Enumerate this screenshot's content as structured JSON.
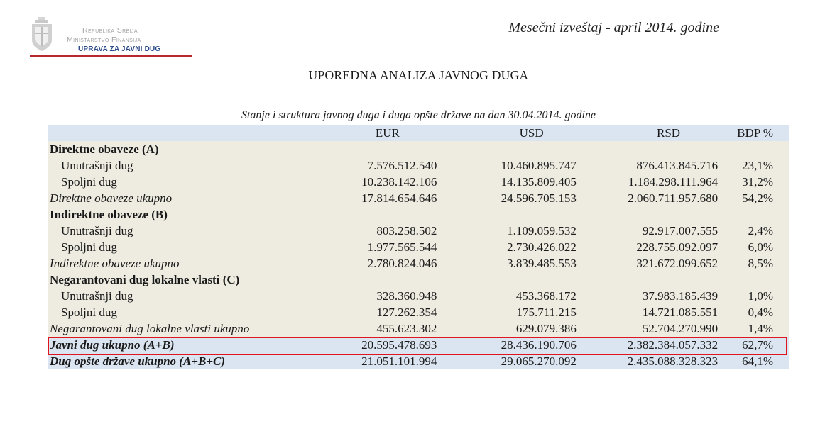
{
  "header": {
    "org_line1": "Republika Srbija",
    "org_line2": "Ministarstvo Finansija",
    "org_line3": "UPRAVA ZA JAVNI DUG",
    "report_title": "Mesečni izveštaj - april 2014. godine"
  },
  "main_title": "UPOREDNA ANALIZA JAVNOG DUGA",
  "table": {
    "caption": "Stanje i struktura javnog duga i duga opšte države na dan 30.04.2014. godine",
    "columns": [
      "",
      "EUR",
      "USD",
      "RSD",
      "BDP %"
    ],
    "rows": [
      {
        "label": "Direktne obaveze (A)",
        "eur": "",
        "usd": "",
        "rsd": "",
        "bdp": ""
      },
      {
        "label": "Unutrašnji dug",
        "eur": "7.576.512.540",
        "usd": "10.460.895.747",
        "rsd": "876.413.845.716",
        "bdp": "23,1%"
      },
      {
        "label": "Spoljni dug",
        "eur": "10.238.142.106",
        "usd": "14.135.809.405",
        "rsd": "1.184.298.111.964",
        "bdp": "31,2%"
      },
      {
        "label": "Direktne obaveze ukupno",
        "eur": "17.814.654.646",
        "usd": "24.596.705.153",
        "rsd": "2.060.711.957.680",
        "bdp": "54,2%"
      },
      {
        "label": "Indirektne obaveze (B)",
        "eur": "",
        "usd": "",
        "rsd": "",
        "bdp": ""
      },
      {
        "label": "Unutrašnji dug",
        "eur": "803.258.502",
        "usd": "1.109.059.532",
        "rsd": "92.917.007.555",
        "bdp": "2,4%"
      },
      {
        "label": "Spoljni dug",
        "eur": "1.977.565.544",
        "usd": "2.730.426.022",
        "rsd": "228.755.092.097",
        "bdp": "6,0%"
      },
      {
        "label": "Indirektne obaveze ukupno",
        "eur": "2.780.824.046",
        "usd": "3.839.485.553",
        "rsd": "321.672.099.652",
        "bdp": "8,5%"
      },
      {
        "label": "Negarantovani dug lokalne vlasti (C)",
        "eur": "",
        "usd": "",
        "rsd": "",
        "bdp": ""
      },
      {
        "label": "Unutrašnji dug",
        "eur": "328.360.948",
        "usd": "453.368.172",
        "rsd": "37.983.185.439",
        "bdp": "1,0%"
      },
      {
        "label": "Spoljni dug",
        "eur": "127.262.354",
        "usd": "175.711.215",
        "rsd": "14.721.085.551",
        "bdp": "0,4%"
      },
      {
        "label": "Negarantovani dug lokalne vlasti ukupno",
        "eur": "455.623.302",
        "usd": "629.079.386",
        "rsd": "52.704.270.990",
        "bdp": "1,4%"
      },
      {
        "label": "Javni dug ukupno (A+B)",
        "eur": "20.595.478.693",
        "usd": "28.436.190.706",
        "rsd": "2.382.384.057.332",
        "bdp": "62,7%"
      },
      {
        "label": "Dug opšte države ukupno (A+B+C)",
        "eur": "21.051.101.994",
        "usd": "29.065.270.092",
        "rsd": "2.435.088.328.323",
        "bdp": "64,1%"
      }
    ]
  },
  "colors": {
    "header_row_bg": "#dbe5f1",
    "body_row_bg": "#eeece1",
    "highlight_border": "#e0161e",
    "logo_accent": "#b8272e"
  }
}
